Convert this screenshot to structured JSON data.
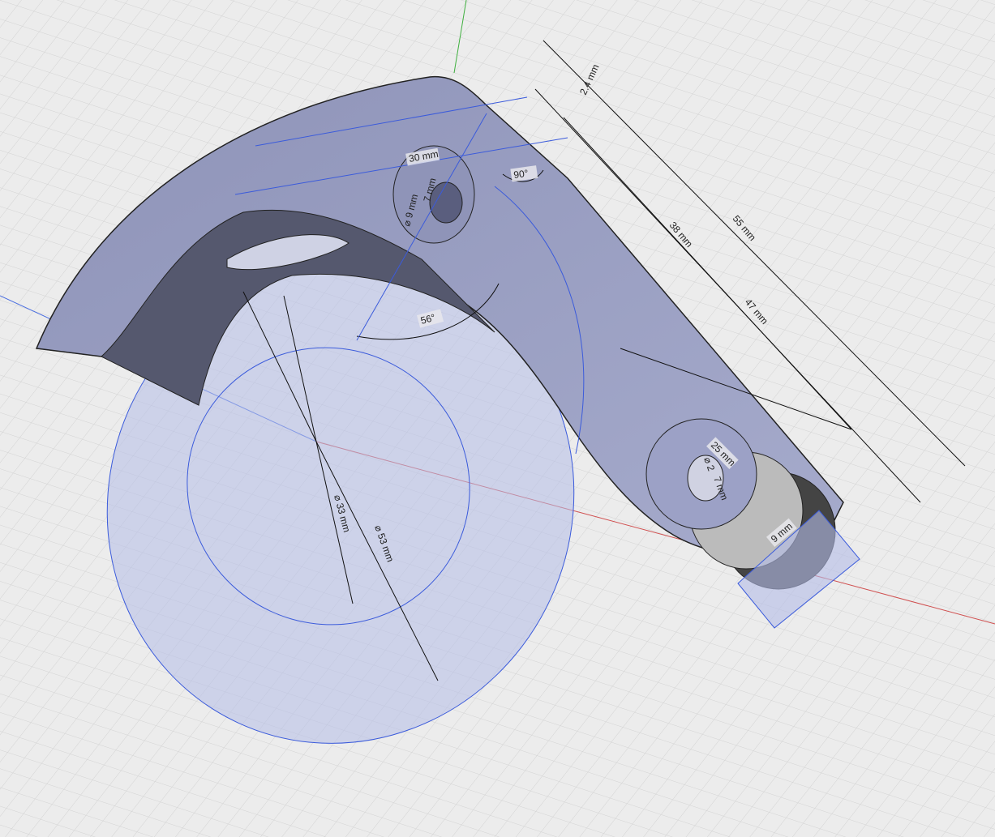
{
  "viewport": {
    "name": "3D CAD model viewport"
  },
  "dimensions": {
    "d_2_4": "2.4 mm",
    "d_30": "30 mm",
    "d_9": "⌀ 9 mm",
    "d_7a": "7 mm",
    "d_90": "90°",
    "d_55": "55 mm",
    "d_38": "38 mm",
    "d_47": "47 mm",
    "d_56": "56°",
    "d_33": "⌀ 33 mm",
    "d_53": "⌀ 53 mm",
    "d_25": "25 mm",
    "d_2": "⌀ 2",
    "d_7b": "7 mm",
    "d_9b": "9 mm"
  },
  "colors": {
    "part": "#9aa0c4",
    "sketch": "#3b5bdb",
    "grid": "#d6d6d6",
    "x_axis": "#d04040",
    "y_axis": "#40b040"
  }
}
